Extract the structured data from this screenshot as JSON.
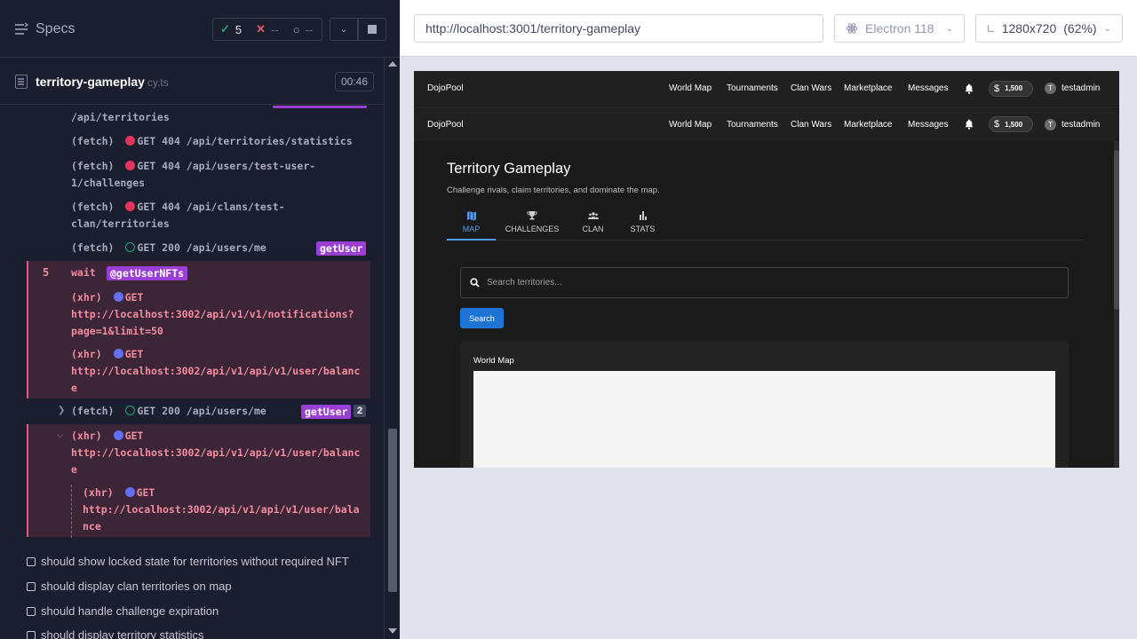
{
  "reporter": {
    "specs_label": "Specs",
    "stats": {
      "passed": "5",
      "failed": "--",
      "pending": "--"
    },
    "spec_name": "territory-gameplay",
    "spec_ext": "cy.ts",
    "duration": "00:46",
    "commands": [
      {
        "text": "/api/territories"
      },
      {
        "method": "(fetch)",
        "status": "GET 404 /api/territories/statistics"
      },
      {
        "method": "(fetch)",
        "status": "GET 404 /api/users/test-user-",
        "cont": "1/challenges"
      },
      {
        "method": "(fetch)",
        "status": "GET 404 /api/clans/test-",
        "cont": "clan/territories"
      },
      {
        "method": "(fetch)",
        "status": "GET 200 /api/users/me",
        "alias": "getUser"
      },
      {
        "num": "5",
        "method": "wait",
        "alias": "@getUserNFTs"
      },
      {
        "method": "(xhr)",
        "status": "GET",
        "url1": "http://localhost:3002/api/v1/v1/notifications?",
        "url2": "page=1&limit=50"
      },
      {
        "method": "(xhr)",
        "status": "GET",
        "url1": "http://localhost:3002/api/v1/api/v1/user/balanc",
        "url2": "e"
      },
      {
        "method": "(fetch)",
        "status": "GET 200 /api/users/me",
        "alias": "getUser",
        "count": "2"
      },
      {
        "method": "(xhr)",
        "status": "GET",
        "url1": "http://localhost:3002/api/v1/api/v1/user/balanc",
        "url2": "e"
      },
      {
        "method": "(xhr)",
        "status": "GET",
        "url1": "http://localhost:3002/api/v1/api/v1/user/bala",
        "url2": "nce"
      }
    ],
    "tests": [
      "should show locked state for territories without required NFT",
      "should display clan territories on map",
      "should handle challenge expiration",
      "should display territory statistics"
    ]
  },
  "browser": {
    "url": "http://localhost:3001/territory-gameplay",
    "engine": "Electron 118",
    "viewport": "1280x720",
    "zoom": "(62%)"
  },
  "app": {
    "brand": "DojoPool",
    "nav": [
      "World Map",
      "Tournaments",
      "Clan Wars",
      "Marketplace",
      "Messages"
    ],
    "balance": "1,500",
    "user_initial": "T",
    "username": "testadmin",
    "page_title": "Territory Gameplay",
    "page_subtitle": "Challenge rivals, claim territories, and dominate the map.",
    "tabs": [
      {
        "label": "MAP",
        "icon": "map-icon",
        "active": true
      },
      {
        "label": "CHALLENGES",
        "icon": "trophy-icon"
      },
      {
        "label": "CLAN",
        "icon": "group-icon"
      },
      {
        "label": "STATS",
        "icon": "bar-chart-icon"
      }
    ],
    "search_placeholder": "Search territories...",
    "search_button": "Search",
    "map_title": "World Map"
  },
  "colors": {
    "reporter_bg": "#1b1e2e",
    "failed_block": "#3b2537",
    "alias_badge": "#9b3fd4",
    "accent_blue": "#1e74d6",
    "active_tab": "#4a9df2"
  }
}
